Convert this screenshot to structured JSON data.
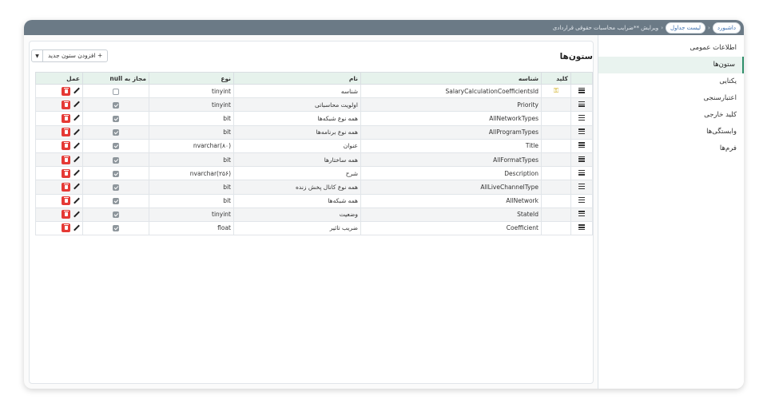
{
  "breadcrumb": {
    "dashboard": "داشبورد",
    "tables_list": "لیست جداول",
    "current": "ویرایش **ضرایب محاسبات حقوقی قراردادی"
  },
  "sidebar": {
    "items": [
      {
        "label": "اطلاعات عمومی",
        "active": false
      },
      {
        "label": "ستون‌ها",
        "active": true
      },
      {
        "label": "یکتایی",
        "active": false
      },
      {
        "label": "اعتبارسنجی",
        "active": false
      },
      {
        "label": "کلید خارجی",
        "active": false
      },
      {
        "label": "وابستگی‌ها",
        "active": false
      },
      {
        "label": "فرم‌ها",
        "active": false
      }
    ]
  },
  "main": {
    "title": "ستون‌ها",
    "add_button": "+ افزودن ستون جدید",
    "dropdown_icon": "caret-down-icon"
  },
  "table": {
    "headers": {
      "key": "کلید",
      "identifier": "شناسه",
      "name": "نام",
      "type": "نوع",
      "nullable": "مجاز به null",
      "action": "عمل"
    },
    "rows": [
      {
        "is_key": true,
        "identifier": "SalaryCalculationCoefficientsId",
        "name": "شناسه",
        "type": "tinyint",
        "nullable": false
      },
      {
        "is_key": false,
        "identifier": "Priority",
        "name": "اولویت محاسباتی",
        "type": "tinyint",
        "nullable": true
      },
      {
        "is_key": false,
        "identifier": "AllNetworkTypes",
        "name": "همه نوع شبکه‌ها",
        "type": "bit",
        "nullable": true
      },
      {
        "is_key": false,
        "identifier": "AllProgramTypes",
        "name": "همه نوع برنامه‌ها",
        "type": "bit",
        "nullable": true
      },
      {
        "is_key": false,
        "identifier": "Title",
        "name": "عنوان",
        "type": "nvarchar(۸۰)",
        "nullable": true
      },
      {
        "is_key": false,
        "identifier": "AllFormatTypes",
        "name": "همه ساختارها",
        "type": "bit",
        "nullable": true
      },
      {
        "is_key": false,
        "identifier": "Description",
        "name": "شرح",
        "type": "nvarchar(۲۵۶)",
        "nullable": true
      },
      {
        "is_key": false,
        "identifier": "AllLiveChannelType",
        "name": "همه نوع کانال پخش زنده",
        "type": "bit",
        "nullable": true
      },
      {
        "is_key": false,
        "identifier": "AllNetwork",
        "name": "همه شبکه‌ها",
        "type": "bit",
        "nullable": true
      },
      {
        "is_key": false,
        "identifier": "StateId",
        "name": "وضعیت",
        "type": "tinyint",
        "nullable": true
      },
      {
        "is_key": false,
        "identifier": "Coefficient",
        "name": "ضریب تاثیر",
        "type": "float",
        "nullable": true
      }
    ]
  },
  "colors": {
    "topbar": "#6b7a86",
    "header_bg": "#e6f2ec",
    "active_accent": "#2f8f6a",
    "delete": "#e53935",
    "key": "#c9a400"
  }
}
